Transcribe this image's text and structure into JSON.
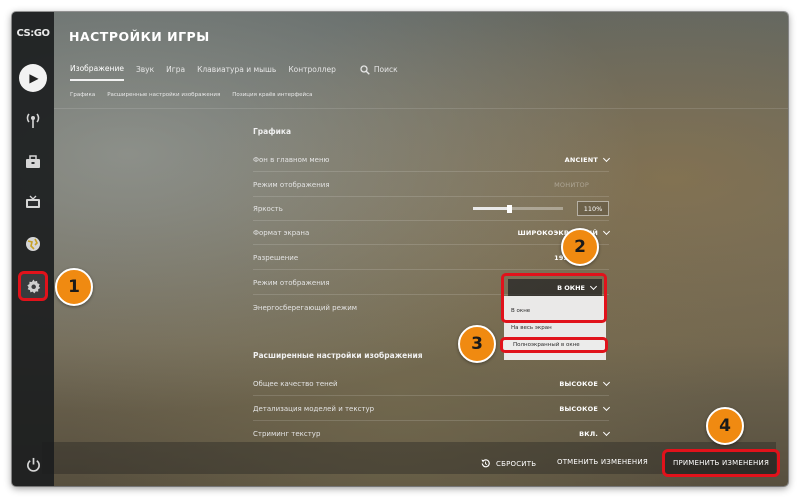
{
  "app": {
    "logo_text": "CS:GO",
    "title": "НАСТРОЙКИ ИГРЫ"
  },
  "rail": {
    "items": [
      {
        "name": "play",
        "icon": "play-icon"
      },
      {
        "name": "broadcast",
        "icon": "antenna-icon"
      },
      {
        "name": "inventory",
        "icon": "briefcase-icon"
      },
      {
        "name": "watch",
        "icon": "tv-icon"
      },
      {
        "name": "stats",
        "icon": "globe-icon"
      },
      {
        "name": "settings",
        "icon": "gear-icon"
      },
      {
        "name": "power",
        "icon": "power-icon"
      }
    ]
  },
  "tabs": [
    {
      "label": "Изображение",
      "active": true
    },
    {
      "label": "Звук"
    },
    {
      "label": "Игра"
    },
    {
      "label": "Клавиатура и мышь"
    },
    {
      "label": "Контроллер"
    }
  ],
  "search_label": "Поиск",
  "subnav": [
    "Графика",
    "Расширенные настройки изображения",
    "Позиция краёв интерфейса"
  ],
  "graphics": {
    "section_title": "Графика",
    "rows": [
      {
        "label": "Фон в главном меню",
        "value": "ANCIENT"
      },
      {
        "label": "Режим отображения",
        "value": "МОНИТОР"
      },
      {
        "label": "Яркость",
        "value": "110%",
        "slider_fraction": 0.4
      },
      {
        "label": "Формат экрана",
        "value": "ШИРОКОЭКРАННЫЙ"
      },
      {
        "label": "Разрешение",
        "value": "1920"
      },
      {
        "label": "Режим отображения",
        "value": "В ОКНЕ"
      },
      {
        "label": "Энергосберегающий режим",
        "value": ""
      }
    ]
  },
  "dropdown": {
    "selected": "В ОКНЕ",
    "options": [
      "В окне",
      "На весь экран",
      "Полноэкранный в окне"
    ]
  },
  "advanced": {
    "section_title": "Расширенные настройки изображения",
    "rows": [
      {
        "label": "Общее качество теней",
        "value": "ВЫСОКОЕ"
      },
      {
        "label": "Детализация моделей и текстур",
        "value": "ВЫСОКОЕ"
      },
      {
        "label": "Стриминг текстур",
        "value": "ВКЛ."
      }
    ]
  },
  "footer": {
    "reset": "СБРОСИТЬ",
    "cancel": "ОТМЕНИТЬ ИЗМЕНЕНИЯ",
    "apply": "ПРИМЕНИТЬ ИЗМЕНЕНИЯ"
  },
  "badges": [
    "1",
    "2",
    "3",
    "4"
  ],
  "colors": {
    "highlight": "#e1121b",
    "badge": "#f08a11"
  }
}
